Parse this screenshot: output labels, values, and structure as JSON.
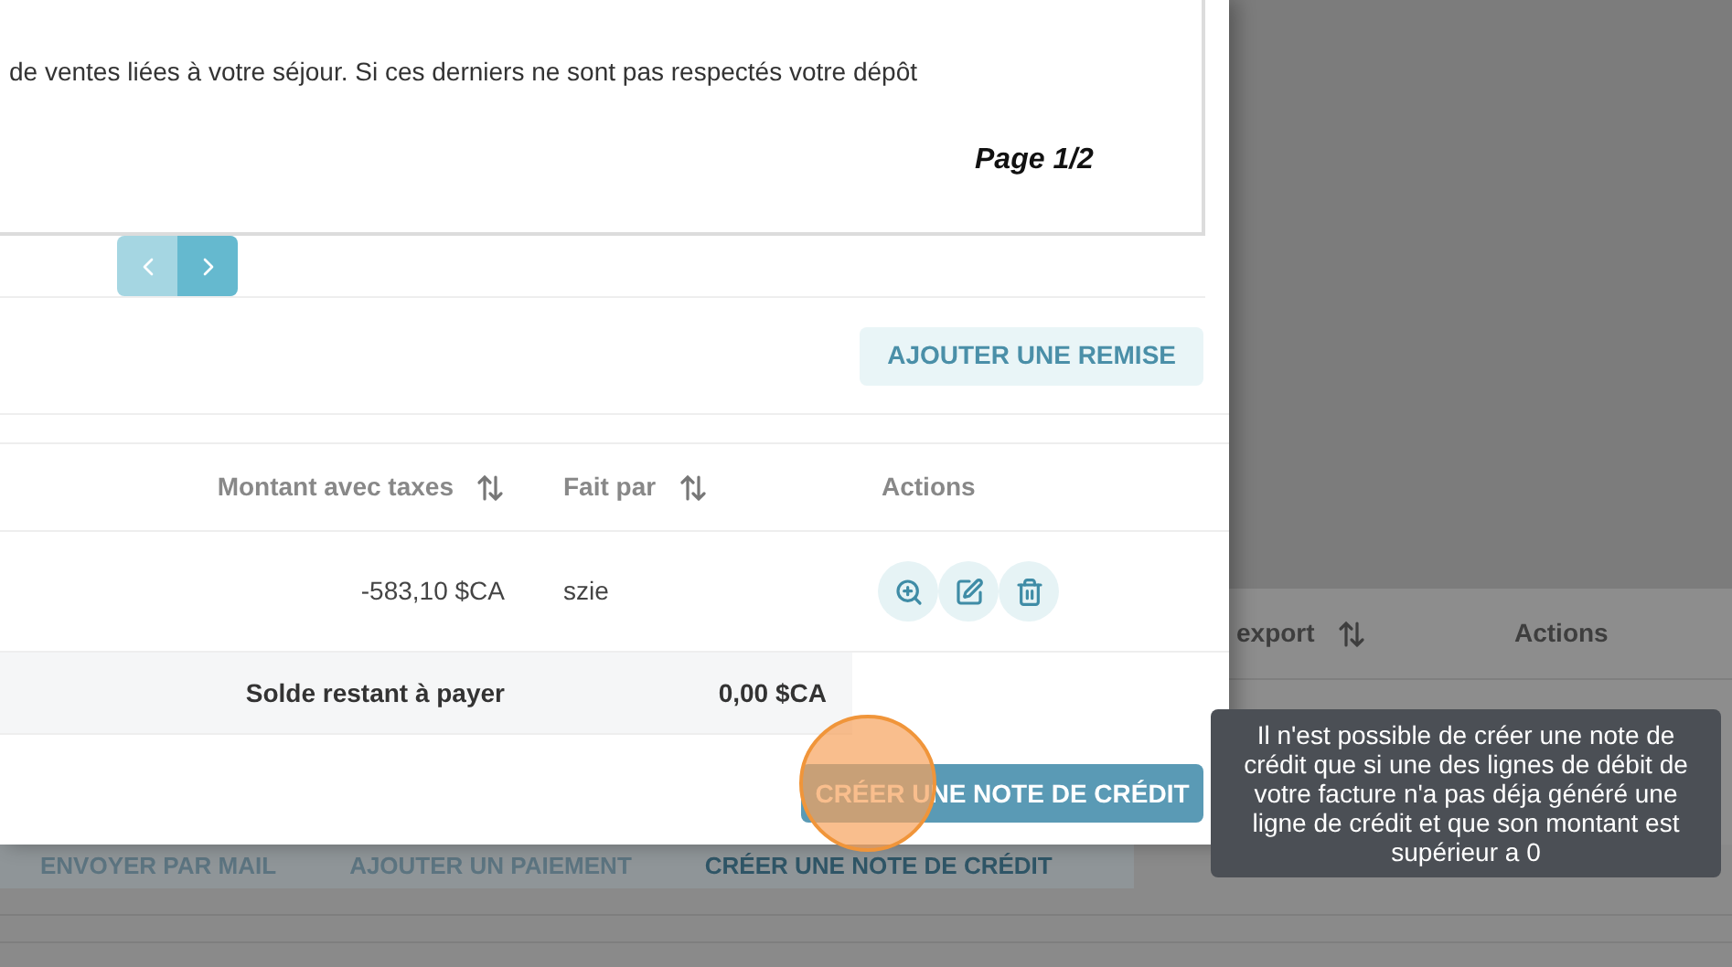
{
  "background_page": {
    "columns": [
      "export",
      "Actions"
    ],
    "buttons": [
      {
        "label": "ENVOYER PAR MAIL",
        "emphasis": false
      },
      {
        "label": "AJOUTER UN PAIEMENT",
        "emphasis": false
      },
      {
        "label": "CRÉER UNE NOTE DE CRÉDIT",
        "emphasis": true
      }
    ]
  },
  "modal": {
    "document": {
      "text": "de ventes liées à votre séjour. Si ces derniers ne sont pas respectés votre dépôt",
      "page": "Page 1/2"
    },
    "pagination": [
      {
        "kind": "prev",
        "disabled": true
      },
      {
        "kind": "next",
        "disabled": false
      }
    ],
    "add_discount_button": "AJOUTER UNE REMISE",
    "table": {
      "columns": [
        {
          "label": "Montant avec taxes",
          "sortable": true
        },
        {
          "label": "Fait par",
          "sortable": true
        },
        {
          "label": "Actions",
          "sortable": false
        }
      ],
      "rows": [
        {
          "amount": "-583,10 $CA",
          "by": "szie",
          "actions": [
            {
              "kind": "view"
            },
            {
              "kind": "edit"
            },
            {
              "kind": "delete"
            }
          ]
        }
      ],
      "summary": {
        "label": "Solde restant à payer",
        "value": "0,00 $CA"
      }
    },
    "credit_button": "CRÉER UNE NOTE DE CRÉDIT"
  },
  "tooltip": "Il n'est possible de créer une note de crédit que si une des lignes de débit de votre facture n'a pas déja généré une ligne de crédit et que son montant est supérieur a 0"
}
